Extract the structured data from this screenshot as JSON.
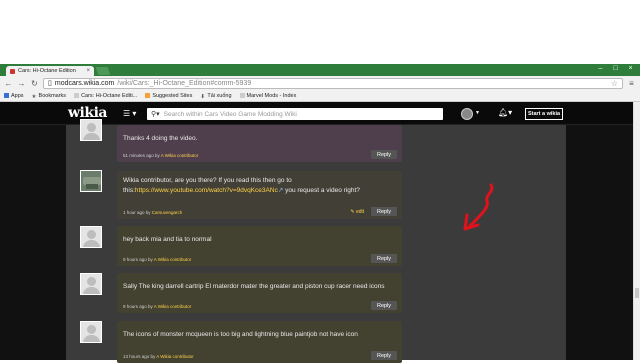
{
  "browser": {
    "tab_title": "Cars: Hi-Octane Edition",
    "tab_close": "×",
    "window_controls": [
      "–",
      "□",
      "×"
    ],
    "url_domain": "modcars.wikia.com",
    "url_rest": "/wiki/Cars:_Hi-Octane_Edition#comm-5939",
    "bookmarks": [
      "Apps",
      "Bookmarks",
      "Cars: Hi-Octane Editi...",
      "Suggested Sites",
      "Tải xuống",
      "Marvel Mods - Index"
    ]
  },
  "wikia": {
    "logo": "wikia",
    "search_placeholder": "Search within Cars Video Game Modding Wiki",
    "start_wiki": "Start a wikia"
  },
  "comments": [
    {
      "text": "Thanks 4 doing the video.",
      "time": "51 minutes ago by ",
      "author": "A Wikia contributor",
      "reply": "Reply"
    },
    {
      "text_before": "Wikia contributor, are you there? If you read this then go to this:",
      "link": "https://www.youtube.com/watch?v=9dvqKce3ANc",
      "text_after": " you request a video right?",
      "time": "1 hour ago by ",
      "author": "Carsuvengarch",
      "edit": "edit",
      "reply": "Reply"
    },
    {
      "text": "hey back mia and tia to normal",
      "time": "9 hours ago by ",
      "author": "A Wikia contributor",
      "reply": "Reply"
    },
    {
      "text": "Sally The king darrell cartrip El materdor mater the greater and piston cup racer need icons",
      "time": "9 hours ago by ",
      "author": "A Wikia contributor",
      "reply": "Reply"
    },
    {
      "text": "The icons of monster mcqueen is too big and lightning blue paintjob not have icon",
      "time": "13 hours ago by ",
      "author": "A Wikia contributor",
      "reply": "Reply"
    }
  ],
  "colors": {
    "link": "#ffd24a",
    "annotation_arrow": "#e0121b"
  }
}
